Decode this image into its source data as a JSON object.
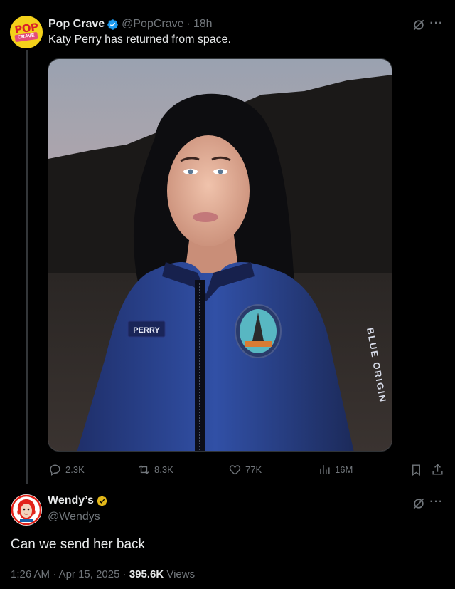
{
  "tweet1": {
    "author_name": "Pop Crave",
    "handle": "@PopCrave",
    "time": "18h",
    "text": "Katy Perry has returned from space.",
    "avatar_text_top": "POP",
    "avatar_text_bottom": "CRAVE",
    "image_alt": "Katy Perry in blue flight suit with PERRY name patch",
    "suit_patch_text": "PERRY",
    "sleeve_text": "BLUE ORIGIN",
    "stats": {
      "replies": "2.3K",
      "reposts": "8.3K",
      "likes": "77K",
      "views": "16M"
    }
  },
  "tweet2": {
    "author_name": "Wendy’s",
    "handle": "@Wendys",
    "text": "Can we send her back",
    "time": "1:26 AM",
    "date": "Apr 15, 2025",
    "views_count": "395.6K",
    "views_label": "Views",
    "separator": "·"
  },
  "colors": {
    "verified_blue": "#1d9bf0",
    "verified_gold": "#e2b719",
    "muted": "#71767b",
    "text": "#e7e9ea"
  },
  "icons": [
    "grok-icon",
    "more-icon",
    "reply-icon",
    "repost-icon",
    "like-icon",
    "views-icon",
    "bookmark-icon",
    "share-icon"
  ]
}
